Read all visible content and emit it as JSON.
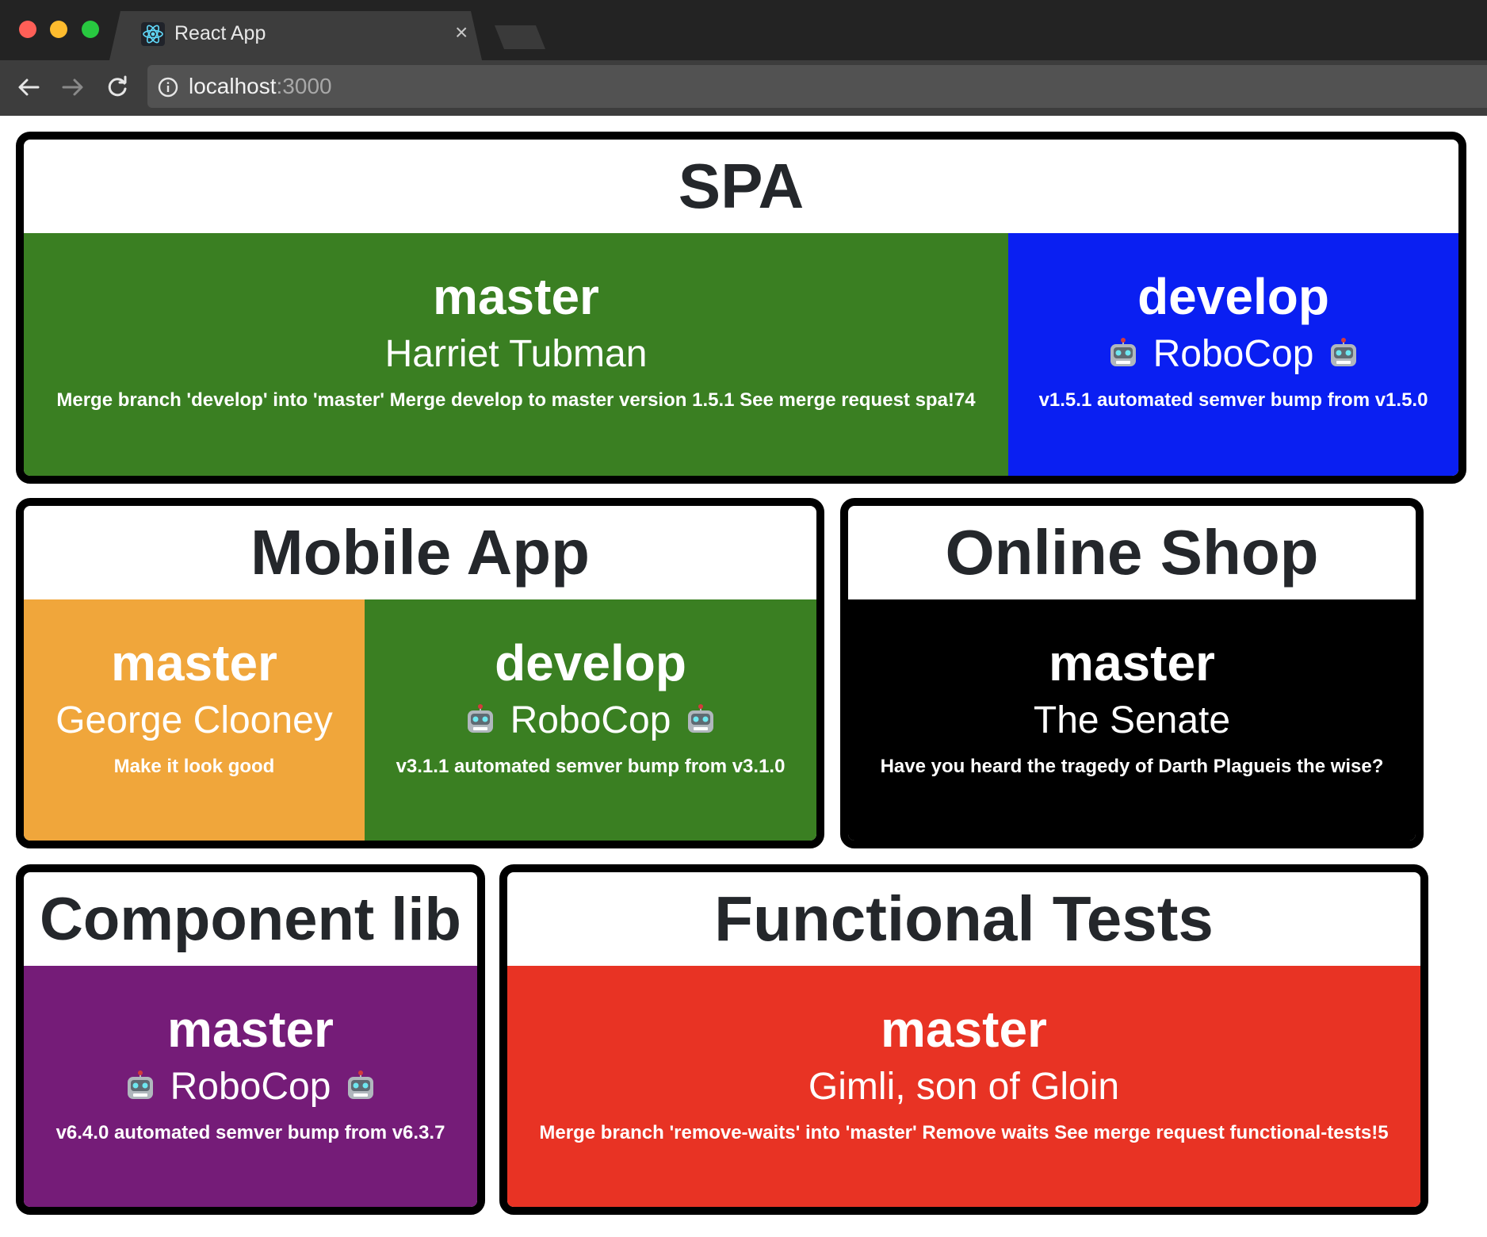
{
  "browser": {
    "tab_title": "React App",
    "tab_close": "×",
    "url_host": "localhost",
    "url_port": ":3000",
    "icons": [
      "react-logo-icon",
      "close-icon",
      "back-arrow-icon",
      "forward-arrow-icon",
      "reload-icon",
      "info-icon"
    ]
  },
  "projects": {
    "spa": {
      "title": "SPA",
      "branches": [
        {
          "name": "master",
          "author": "Harriet Tubman",
          "message": "Merge branch 'develop' into 'master' Merge develop to master version 1.5.1 See merge request spa!74",
          "color": "#3a7f22"
        },
        {
          "name": "develop",
          "author": "RoboCop",
          "message": "v1.5.1 automated semver bump from v1.5.0",
          "color": "#0a1ff2"
        }
      ]
    },
    "mobile": {
      "title": "Mobile App",
      "branches": [
        {
          "name": "master",
          "author": "George Clooney",
          "message": "Make it look good",
          "color": "#f0a63b"
        },
        {
          "name": "develop",
          "author": "RoboCop",
          "message": "v3.1.1 automated semver bump from v3.1.0",
          "color": "#3a7f22"
        }
      ]
    },
    "shop": {
      "title": "Online Shop",
      "branches": [
        {
          "name": "master",
          "author": "The Senate",
          "message": "Have you heard the tragedy of Darth Plagueis the wise?",
          "color": "#000000"
        }
      ]
    },
    "component_lib": {
      "title": "Component lib",
      "branches": [
        {
          "name": "master",
          "author": "RoboCop",
          "message": "v6.4.0 automated semver bump from v6.3.7",
          "color": "#751c78"
        }
      ]
    },
    "functional_tests": {
      "title": "Functional Tests",
      "branches": [
        {
          "name": "master",
          "author": "Gimli, son of Gloin",
          "message": "Merge branch 'remove-waits' into 'master' Remove waits See merge request functional-tests!5",
          "color": "#e83324"
        }
      ]
    }
  },
  "robot_icon": "robot-face-icon"
}
